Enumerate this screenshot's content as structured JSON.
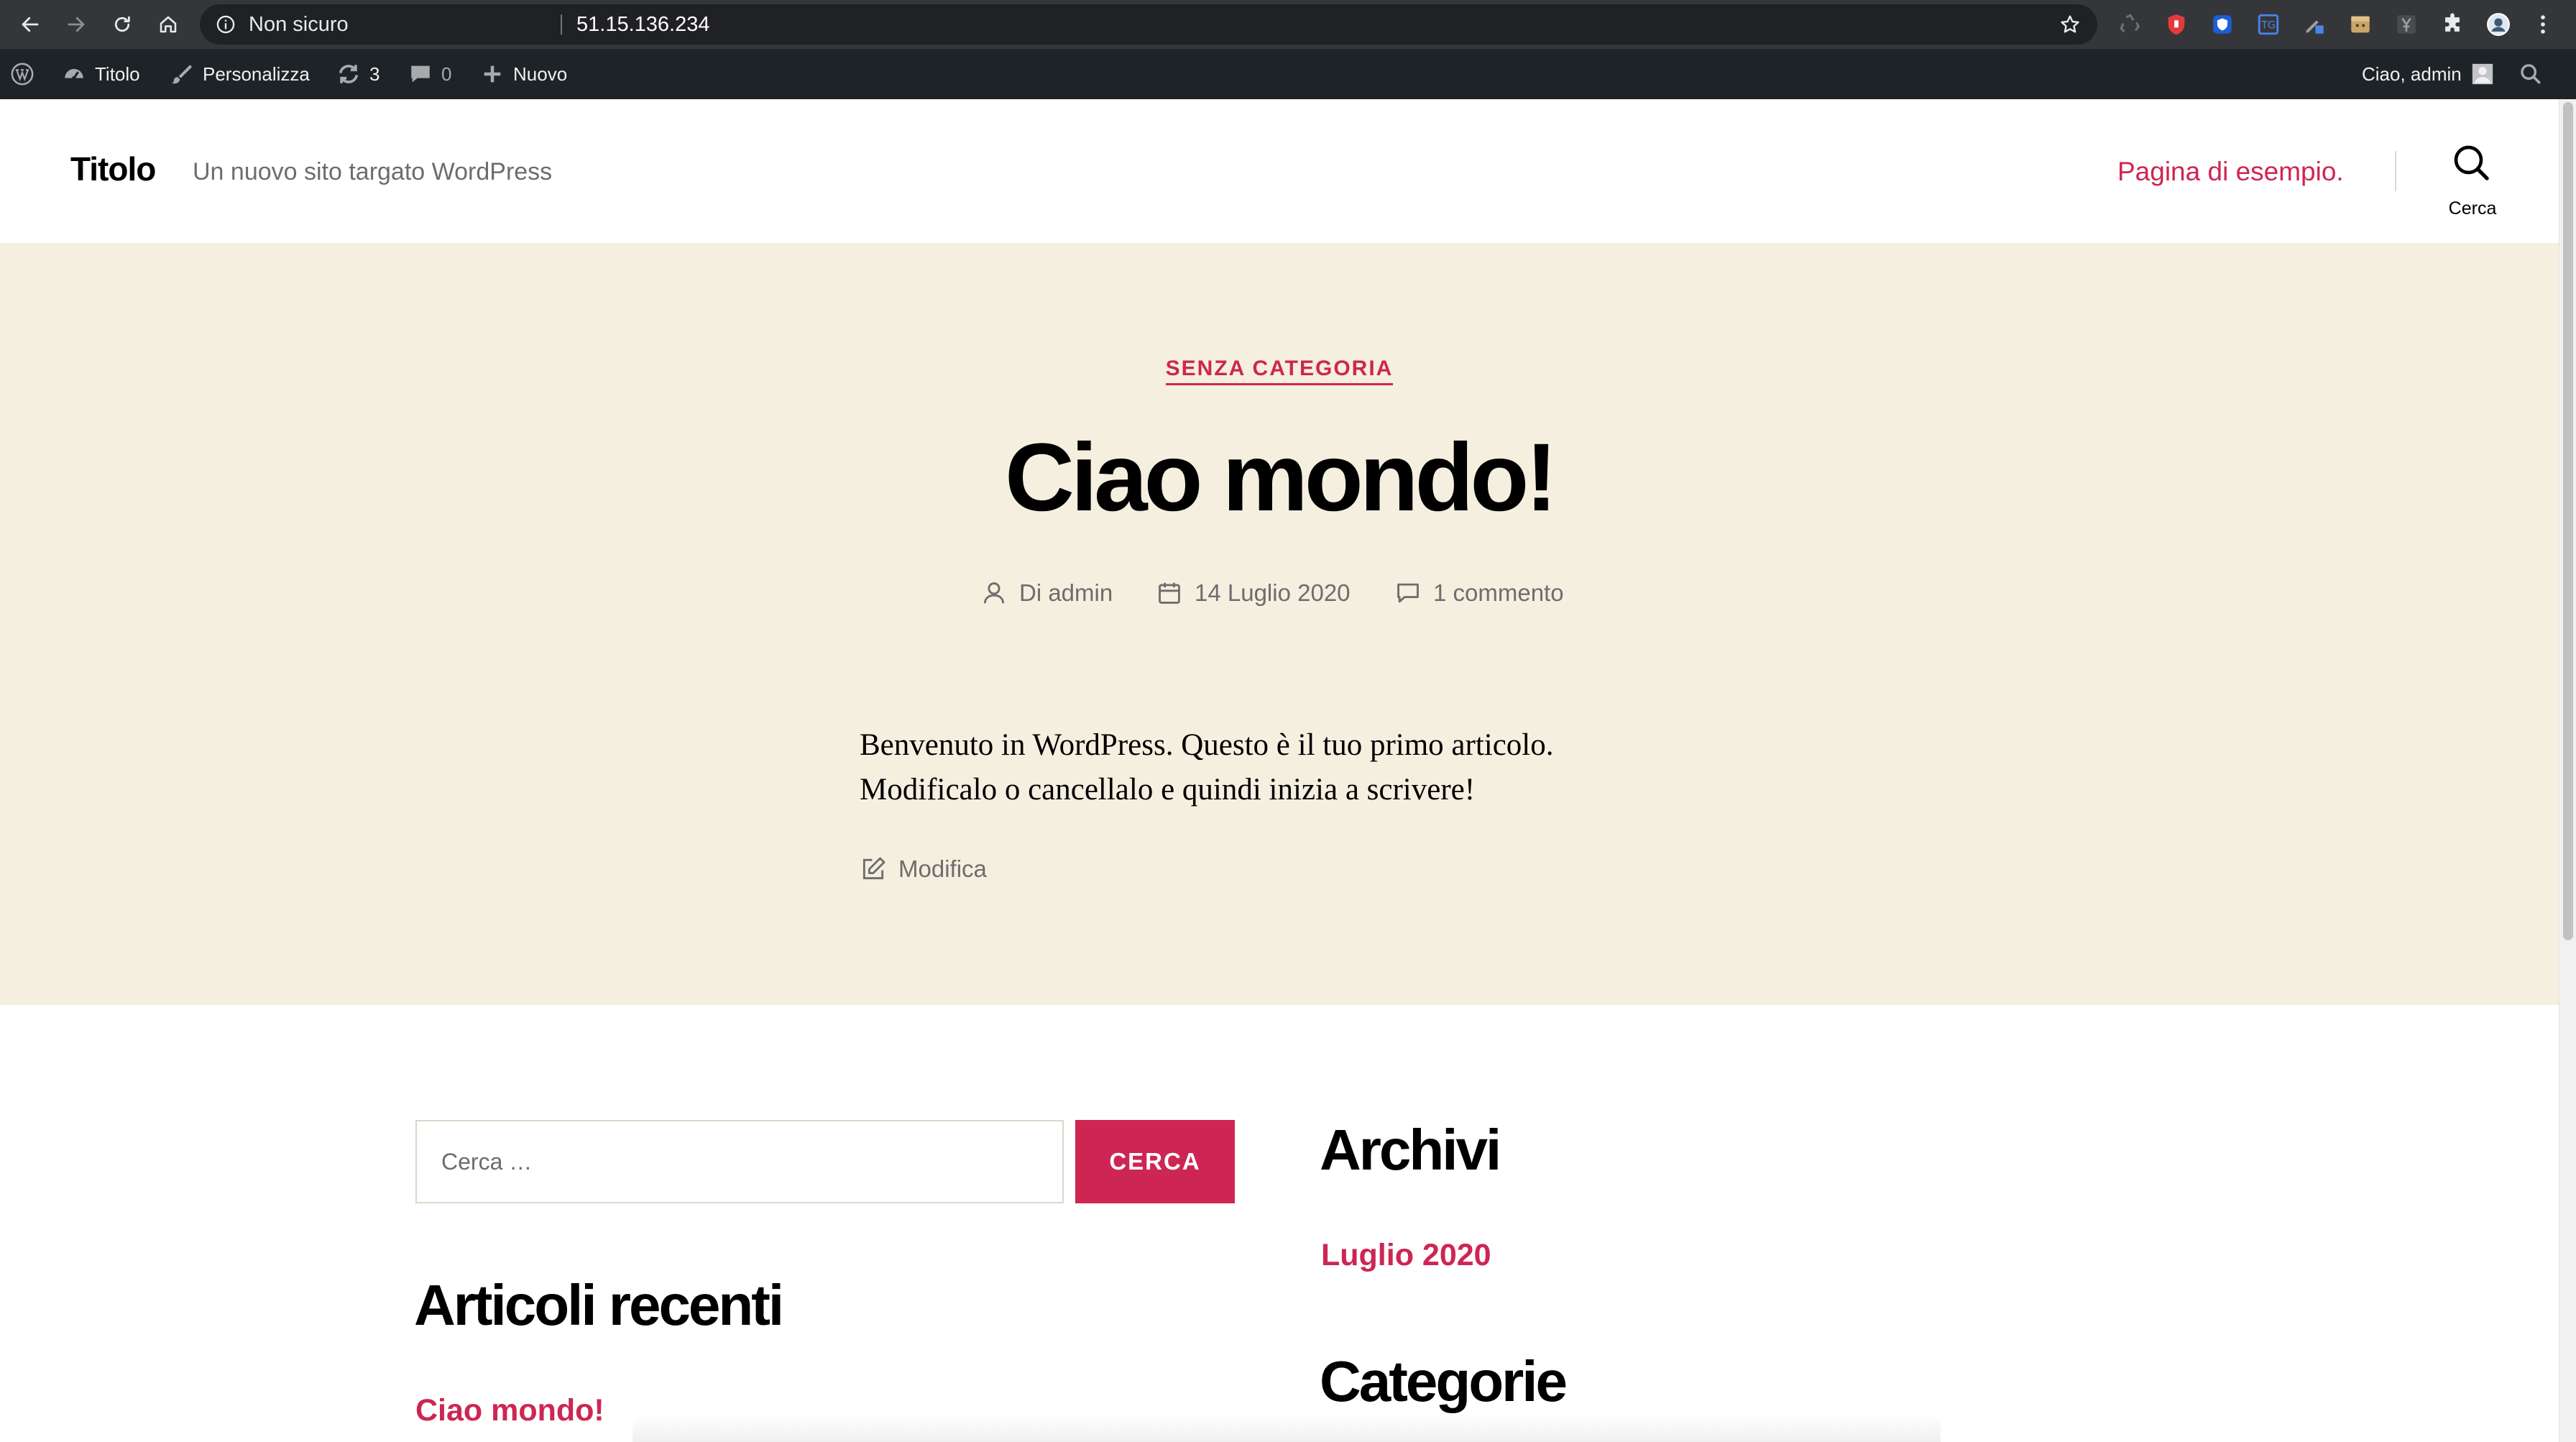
{
  "browser": {
    "security_label": "Non sicuro",
    "url": "51.15.136.234",
    "icons": {
      "back": "arrow-left-icon",
      "forward": "arrow-right-icon",
      "reload": "reload-icon",
      "home": "home-icon",
      "info": "info-icon",
      "bookmark": "star-icon",
      "extensions": "puzzle-icon",
      "profile": "avatar-icon",
      "menu": "kebab-menu-icon"
    },
    "extension_colors": [
      "#8e8e8e",
      "#e23b3b",
      "#1a5fd6",
      "#4a86e8",
      "#9aa0a6",
      "#c9a46b",
      "#8e8e8e"
    ]
  },
  "admin_bar": {
    "site_name": "Titolo",
    "customize": "Personalizza",
    "updates_count": "3",
    "comments_count": "0",
    "new_label": "Nuovo",
    "greeting": "Ciao, admin"
  },
  "header": {
    "site_title": "Titolo",
    "site_description": "Un nuovo sito targato WordPress",
    "nav_link": "Pagina di esempio.",
    "search_label": "Cerca"
  },
  "post": {
    "category": "SENZA CATEGORIA",
    "title": "Ciao mondo!",
    "author": "Di admin",
    "date": "14 Luglio 2020",
    "comments": "1 commento",
    "content_line1": "Benvenuto in WordPress. Questo è il tuo primo articolo.",
    "content_line2": "Modificalo o cancellalo e quindi inizia a scrivere!",
    "edit_label": "Modifica"
  },
  "widgets": {
    "search_placeholder": "Cerca …",
    "search_button": "CERCA",
    "recent_title": "Articoli recenti",
    "recent_items": [
      "Ciao mondo!"
    ],
    "archives_title": "Archivi",
    "archives_items": [
      "Luglio 2020"
    ],
    "categories_title": "Categorie"
  },
  "colors": {
    "accent": "#cd2653",
    "hero_background": "#f5efe0",
    "admin_bar": "#1d2327",
    "browser_chrome": "#35363a"
  }
}
